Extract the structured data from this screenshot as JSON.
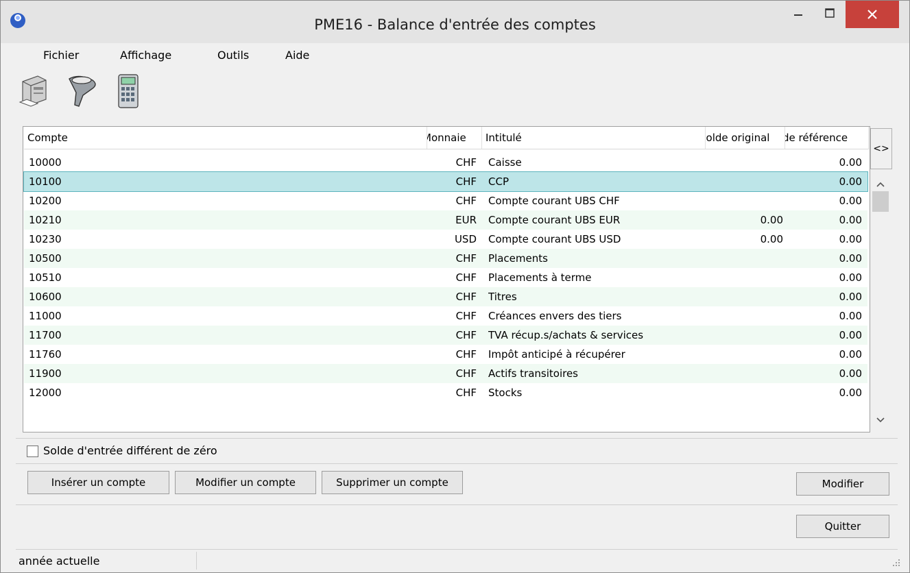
{
  "window": {
    "title": "PME16 - Balance d'entrée des comptes",
    "controls": {
      "minimize": "–",
      "maximize": "☐",
      "close": "✕"
    }
  },
  "menu": {
    "items": [
      "Fichier",
      "Affichage",
      "Outils",
      "Aide"
    ]
  },
  "toolbar": {
    "icons": [
      "printer-icon",
      "filter-funnel-icon",
      "calculator-icon"
    ]
  },
  "table": {
    "columns": [
      "Compte",
      "Monnaie",
      "Intitulé",
      "Solde original",
      "Solde de référence"
    ],
    "column_headers_visible": [
      "Compte",
      "Monnaie",
      "Intitulé",
      "Solde original",
      "de référence"
    ],
    "toggle_label": "<>",
    "rows": [
      {
        "compte": "10000",
        "monnaie": "CHF",
        "intitule": "Caisse",
        "original": "",
        "reference": "0.00"
      },
      {
        "compte": "10100",
        "monnaie": "CHF",
        "intitule": "CCP",
        "original": "",
        "reference": "0.00"
      },
      {
        "compte": "10200",
        "monnaie": "CHF",
        "intitule": "Compte courant UBS CHF",
        "original": "",
        "reference": "0.00"
      },
      {
        "compte": "10210",
        "monnaie": "EUR",
        "intitule": "Compte courant UBS EUR",
        "original": "0.00",
        "reference": "0.00"
      },
      {
        "compte": "10230",
        "monnaie": "USD",
        "intitule": "Compte courant UBS USD",
        "original": "0.00",
        "reference": "0.00"
      },
      {
        "compte": "10500",
        "monnaie": "CHF",
        "intitule": "Placements",
        "original": "",
        "reference": "0.00"
      },
      {
        "compte": "10510",
        "monnaie": "CHF",
        "intitule": "Placements à terme",
        "original": "",
        "reference": "0.00"
      },
      {
        "compte": "10600",
        "monnaie": "CHF",
        "intitule": "Titres",
        "original": "",
        "reference": "0.00"
      },
      {
        "compte": "11000",
        "monnaie": "CHF",
        "intitule": "Créances envers des tiers",
        "original": "",
        "reference": "0.00"
      },
      {
        "compte": "11700",
        "monnaie": "CHF",
        "intitule": "TVA récup.s/achats & services",
        "original": "",
        "reference": "0.00"
      },
      {
        "compte": "11760",
        "monnaie": "CHF",
        "intitule": "Impôt anticipé à récupérer",
        "original": "",
        "reference": "0.00"
      },
      {
        "compte": "11900",
        "monnaie": "CHF",
        "intitule": "Actifs transitoires",
        "original": "",
        "reference": "0.00"
      },
      {
        "compte": "12000",
        "monnaie": "CHF",
        "intitule": "Stocks",
        "original": "",
        "reference": "0.00"
      }
    ],
    "selected_row_index": 1
  },
  "filter": {
    "checkbox_label": "Solde d'entrée différent de zéro",
    "checked": false
  },
  "buttons": {
    "insert": "Insérer un compte",
    "edit_account": "Modifier un compte",
    "delete": "Supprimer un compte",
    "modify": "Modifier",
    "quit": "Quitter"
  },
  "status": {
    "text": "année actuelle"
  },
  "colors": {
    "selection": "#bde5e8",
    "alt_row": "#f0faf3",
    "close_button": "#c7413b"
  }
}
